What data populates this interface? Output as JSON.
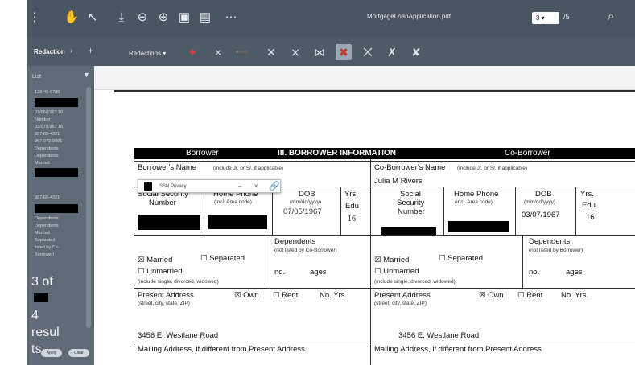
{
  "toolbar": {
    "filename": "MortgageLoanApplication.pdf",
    "page_current": "3",
    "page_sep": "/5",
    "icons": [
      "hand-icon",
      "select-icon",
      "download-icon",
      "zoom-out-icon",
      "zoom-in-icon",
      "save-icon",
      "print-icon",
      "more-icon",
      "search-icon"
    ]
  },
  "redaction_bar": {
    "panel_label": "Redaction",
    "mode_label": "Redactions",
    "icons": [
      "cursor-icon",
      "x-icon",
      "line-icon",
      "x-box-icon",
      "x-strike-icon",
      "x-split-icon",
      "x-active-icon",
      "x-flag-icon",
      "x-arrow-icon",
      "x-check-icon"
    ],
    "accent": "#e53935"
  },
  "sidebar": {
    "list_label": "List",
    "entries": [
      {
        "text": "123-45-6789"
      },
      {
        "text": "07/05/1967 16"
      },
      {
        "text": "Number"
      },
      {
        "text": "03/07/1967 16"
      },
      {
        "text": "987-65-4321"
      },
      {
        "text": "867-973-9061"
      },
      {
        "text": "Dependents"
      },
      {
        "text": "Dependents"
      },
      {
        "text": "Married"
      },
      {
        "text": "987-65-4321"
      },
      {
        "text": "Dependents"
      },
      {
        "text": "Dependents"
      },
      {
        "text": "Married"
      },
      {
        "text": "Separated"
      },
      {
        "text": "listed by Co-"
      },
      {
        "text": "Borrower)"
      }
    ],
    "result_line1": "3 of",
    "result_line2": "4",
    "result_line3": "resul",
    "result_line4": "ts",
    "btn_apply": "Apply",
    "btn_clear": "Clear"
  },
  "popup": {
    "label": "SSN Privacy"
  },
  "form": {
    "header_left": "Borrower",
    "header_center": "III. BORROWER INFORMATION",
    "header_right": "Co-Borrower",
    "b_name_label": "Borrower's Name",
    "b_name_hint": "(include Jr. or Sr. if applicable)",
    "c_name_label": "Co-Borrower's Name",
    "c_name_hint": "(include Jr. or Sr. if applicable)",
    "c_name_value": "Julia M Rivers",
    "b_ssn_label1": "Social Security",
    "b_ssn_label2": "Number",
    "b_phone_label": "Home Phone",
    "b_phone_hint": "(incl. Area code)",
    "b_dob_label": "DOB",
    "b_dob_hint": "(mm/dd/yyyy)",
    "b_dob_value": "07/05/1967",
    "b_yrs_label1": "Yrs.",
    "b_yrs_label2": "Edu",
    "b_yrs_value": "16",
    "c_ssn_label1": "Social",
    "c_ssn_label2": "Security",
    "c_ssn_label3": "Number",
    "c_phone_label": "Home Phone",
    "c_phone_hint": "(incl. Area code)",
    "c_dob_label": "DOB",
    "c_dob_hint": "(mm/dd/yyyy)",
    "c_dob_value": "03/07/1967",
    "c_yrs_label1": "Yrs.",
    "c_yrs_label2": "Edu",
    "c_yrs_value": "16",
    "b_married": "☒ Married",
    "b_separated": "☐ Separated",
    "b_unmarried": "☐ Unmarried",
    "b_marital_hint": "(include single, divorced, widowed)",
    "b_dep_label": "Dependents",
    "b_dep_hint": "(not listed by Co-Borrower)",
    "b_dep_no": "no.",
    "b_dep_ages": "ages",
    "c_married": "☒ Married",
    "c_separated": "☐ Separated",
    "c_unmarried": "☐ Unmarried",
    "c_marital_hint": "(include single, divorced, widowed)",
    "c_dep_label": "Dependents",
    "c_dep_hint": "(not listed by Borrower)",
    "c_dep_no": "no.",
    "c_dep_ages": "ages",
    "b_addr_label": "Present Address",
    "b_addr_hint": "(street, city, state, ZIP)",
    "b_own": "☒ Own",
    "b_rent": "☐ Rent",
    "b_noyrs": "No. Yrs.",
    "b_addr_value": "3456 E. Westlane Road",
    "c_addr_label": "Present Address",
    "c_addr_hint": "(street, city, state, ZIP)",
    "c_own": "☒ Own",
    "c_rent": "☐ Rent",
    "c_noyrs": "No. Yrs.",
    "c_addr_value": "3456 E. Westlane Road",
    "b_mail_label": "Mailing Address, if different from Present Address",
    "c_mail_label": "Mailing Address, if different from Present Address"
  }
}
